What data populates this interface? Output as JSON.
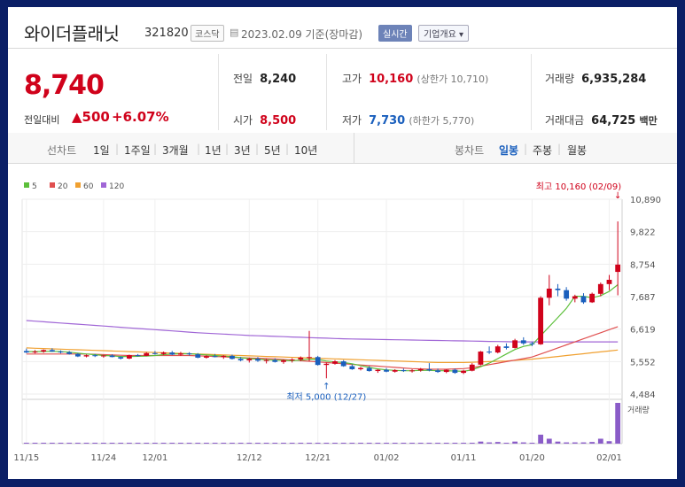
{
  "header": {
    "name": "와이더플래닛",
    "code": "321820",
    "market": "코스닥",
    "date_text": "2023.02.09 기준(장마감)",
    "realtime_label": "실시간",
    "overview_label": "기업개요 ▾"
  },
  "summary": {
    "price": "8,740",
    "change_label": "전일대비",
    "change_arrow": "▲",
    "change": "500",
    "change_pct": "+6.07%",
    "prev_label": "전일",
    "prev": "8,240",
    "high_label": "고가",
    "high": "10,160",
    "high_sub": "(상한가 10,710)",
    "volume_label": "거래량",
    "volume": "6,935,284",
    "open_label": "시가",
    "open": "8,500",
    "low_label": "저가",
    "low": "7,730",
    "low_sub": "(하한가 5,770)",
    "amount_label": "거래대금",
    "amount": "64,725",
    "amount_unit": "백만"
  },
  "toolbar": {
    "line_label": "선차트",
    "periods": [
      "1일",
      "1주일",
      "3개월",
      "1년",
      "3년",
      "5년",
      "10년"
    ],
    "candle_label": "봉차트",
    "candle_daily": "일봉",
    "candle_weekly": "주봉",
    "candle_monthly": "월봉"
  },
  "colors": {
    "up": "#d0021b",
    "down": "#1a5fbd",
    "ma5": "#5cbf3a",
    "ma20": "#e05050",
    "ma60": "#f0a030",
    "ma120": "#a066d6",
    "volume": "#8a5cc8"
  },
  "chart_data": {
    "type": "candlestick",
    "legend": [
      "5",
      "20",
      "60",
      "120"
    ],
    "y_ticks": [
      "10,890",
      "9,822",
      "8,754",
      "7,687",
      "6,619",
      "5,552",
      "4,484"
    ],
    "ylim": [
      4484,
      10890
    ],
    "x_ticks": [
      "11/15",
      "11/24",
      "12/01",
      "12/12",
      "12/21",
      "01/02",
      "01/11",
      "01/20",
      "02/01"
    ],
    "volume_label": "거래량",
    "annotations": {
      "high": "최고 10,160 (02/09)",
      "low": "최저 5,000 (12/27)"
    },
    "candles": [
      {
        "o": 5900,
        "h": 5980,
        "l": 5830,
        "c": 5850
      },
      {
        "o": 5850,
        "h": 5930,
        "l": 5820,
        "c": 5880
      },
      {
        "o": 5880,
        "h": 5950,
        "l": 5840,
        "c": 5930
      },
      {
        "o": 5930,
        "h": 5990,
        "l": 5870,
        "c": 5880
      },
      {
        "o": 5880,
        "h": 5920,
        "l": 5820,
        "c": 5860
      },
      {
        "o": 5860,
        "h": 5900,
        "l": 5780,
        "c": 5800
      },
      {
        "o": 5800,
        "h": 5830,
        "l": 5700,
        "c": 5720
      },
      {
        "o": 5720,
        "h": 5780,
        "l": 5690,
        "c": 5760
      },
      {
        "o": 5760,
        "h": 5800,
        "l": 5700,
        "c": 5730
      },
      {
        "o": 5730,
        "h": 5770,
        "l": 5680,
        "c": 5750
      },
      {
        "o": 5750,
        "h": 5790,
        "l": 5690,
        "c": 5700
      },
      {
        "o": 5700,
        "h": 5720,
        "l": 5620,
        "c": 5650
      },
      {
        "o": 5650,
        "h": 5780,
        "l": 5630,
        "c": 5760
      },
      {
        "o": 5760,
        "h": 5800,
        "l": 5720,
        "c": 5740
      },
      {
        "o": 5740,
        "h": 5860,
        "l": 5730,
        "c": 5830
      },
      {
        "o": 5830,
        "h": 5900,
        "l": 5780,
        "c": 5800
      },
      {
        "o": 5800,
        "h": 5880,
        "l": 5770,
        "c": 5850
      },
      {
        "o": 5850,
        "h": 5900,
        "l": 5760,
        "c": 5780
      },
      {
        "o": 5780,
        "h": 5870,
        "l": 5740,
        "c": 5820
      },
      {
        "o": 5820,
        "h": 5860,
        "l": 5750,
        "c": 5790
      },
      {
        "o": 5790,
        "h": 5830,
        "l": 5660,
        "c": 5680
      },
      {
        "o": 5680,
        "h": 5760,
        "l": 5650,
        "c": 5730
      },
      {
        "o": 5730,
        "h": 5800,
        "l": 5690,
        "c": 5700
      },
      {
        "o": 5700,
        "h": 5760,
        "l": 5640,
        "c": 5740
      },
      {
        "o": 5740,
        "h": 5780,
        "l": 5620,
        "c": 5640
      },
      {
        "o": 5640,
        "h": 5700,
        "l": 5560,
        "c": 5590
      },
      {
        "o": 5590,
        "h": 5680,
        "l": 5520,
        "c": 5640
      },
      {
        "o": 5640,
        "h": 5700,
        "l": 5540,
        "c": 5580
      },
      {
        "o": 5580,
        "h": 5640,
        "l": 5490,
        "c": 5600
      },
      {
        "o": 5600,
        "h": 5660,
        "l": 5520,
        "c": 5540
      },
      {
        "o": 5540,
        "h": 5620,
        "l": 5480,
        "c": 5590
      },
      {
        "o": 5590,
        "h": 5660,
        "l": 5520,
        "c": 5620
      },
      {
        "o": 5620,
        "h": 5720,
        "l": 5560,
        "c": 5680
      },
      {
        "o": 5680,
        "h": 6560,
        "l": 5560,
        "c": 5700
      },
      {
        "o": 5700,
        "h": 5740,
        "l": 5420,
        "c": 5440
      },
      {
        "o": 5440,
        "h": 5520,
        "l": 5000,
        "c": 5480
      },
      {
        "o": 5480,
        "h": 5600,
        "l": 5450,
        "c": 5560
      },
      {
        "o": 5560,
        "h": 5600,
        "l": 5380,
        "c": 5400
      },
      {
        "o": 5400,
        "h": 5460,
        "l": 5280,
        "c": 5300
      },
      {
        "o": 5300,
        "h": 5380,
        "l": 5260,
        "c": 5340
      },
      {
        "o": 5340,
        "h": 5400,
        "l": 5220,
        "c": 5240
      },
      {
        "o": 5240,
        "h": 5300,
        "l": 5180,
        "c": 5280
      },
      {
        "o": 5280,
        "h": 5340,
        "l": 5200,
        "c": 5220
      },
      {
        "o": 5220,
        "h": 5300,
        "l": 5190,
        "c": 5270
      },
      {
        "o": 5270,
        "h": 5320,
        "l": 5210,
        "c": 5240
      },
      {
        "o": 5240,
        "h": 5300,
        "l": 5190,
        "c": 5260
      },
      {
        "o": 5260,
        "h": 5340,
        "l": 5220,
        "c": 5300
      },
      {
        "o": 5300,
        "h": 5500,
        "l": 5230,
        "c": 5260
      },
      {
        "o": 5260,
        "h": 5320,
        "l": 5180,
        "c": 5210
      },
      {
        "o": 5210,
        "h": 5300,
        "l": 5170,
        "c": 5280
      },
      {
        "o": 5280,
        "h": 5320,
        "l": 5150,
        "c": 5180
      },
      {
        "o": 5180,
        "h": 5280,
        "l": 5140,
        "c": 5250
      },
      {
        "o": 5250,
        "h": 5500,
        "l": 5230,
        "c": 5450
      },
      {
        "o": 5450,
        "h": 5900,
        "l": 5430,
        "c": 5880
      },
      {
        "o": 5880,
        "h": 6050,
        "l": 5800,
        "c": 5850
      },
      {
        "o": 5850,
        "h": 6100,
        "l": 5820,
        "c": 6050
      },
      {
        "o": 6050,
        "h": 6150,
        "l": 5950,
        "c": 6000
      },
      {
        "o": 6000,
        "h": 6300,
        "l": 5980,
        "c": 6250
      },
      {
        "o": 6250,
        "h": 6350,
        "l": 6100,
        "c": 6150
      },
      {
        "o": 6150,
        "h": 6200,
        "l": 6060,
        "c": 6120
      },
      {
        "o": 6120,
        "h": 7700,
        "l": 6100,
        "c": 7650
      },
      {
        "o": 7650,
        "h": 8400,
        "l": 7400,
        "c": 7950
      },
      {
        "o": 7950,
        "h": 8100,
        "l": 7700,
        "c": 7900
      },
      {
        "o": 7900,
        "h": 8000,
        "l": 7550,
        "c": 7620
      },
      {
        "o": 7620,
        "h": 7750,
        "l": 7500,
        "c": 7700
      },
      {
        "o": 7700,
        "h": 7800,
        "l": 7450,
        "c": 7500
      },
      {
        "o": 7500,
        "h": 7820,
        "l": 7480,
        "c": 7780
      },
      {
        "o": 7780,
        "h": 8150,
        "l": 7700,
        "c": 8100
      },
      {
        "o": 8100,
        "h": 8400,
        "l": 7900,
        "c": 8240
      },
      {
        "o": 8500,
        "h": 10160,
        "l": 7730,
        "c": 8740
      }
    ],
    "ma5": [
      5880,
      5880,
      5885,
      5890,
      5880,
      5860,
      5830,
      5800,
      5780,
      5750,
      5740,
      5720,
      5720,
      5725,
      5730,
      5750,
      5780,
      5800,
      5810,
      5810,
      5790,
      5770,
      5750,
      5730,
      5710,
      5680,
      5650,
      5630,
      5610,
      5600,
      5590,
      5580,
      5600,
      5630,
      5620,
      5570,
      5540,
      5520,
      5480,
      5420,
      5360,
      5310,
      5280,
      5260,
      5250,
      5250,
      5260,
      5260,
      5250,
      5250,
      5240,
      5230,
      5280,
      5380,
      5500,
      5650,
      5800,
      5950,
      6050,
      6100,
      6400,
      6700,
      7000,
      7300,
      7700,
      7700,
      7650,
      7720,
      7860,
      8080
    ],
    "ma20": [
      5800,
      5800,
      5800,
      5800,
      5800,
      5800,
      5800,
      5800,
      5790,
      5780,
      5770,
      5760,
      5750,
      5750,
      5750,
      5750,
      5750,
      5750,
      5750,
      5750,
      5740,
      5730,
      5720,
      5710,
      5690,
      5680,
      5670,
      5660,
      5650,
      5640,
      5620,
      5600,
      5580,
      5560,
      5540,
      5520,
      5500,
      5480,
      5460,
      5440,
      5420,
      5400,
      5380,
      5360,
      5340,
      5320,
      5310,
      5300,
      5300,
      5300,
      5310,
      5320,
      5350,
      5400,
      5450,
      5500,
      5550,
      5600,
      5650,
      5700,
      5800,
      5900,
      6000,
      6100,
      6200,
      6300,
      6400,
      6500,
      6600,
      6700
    ],
    "ma60": [
      6000,
      5990,
      5980,
      5970,
      5960,
      5950,
      5940,
      5930,
      5920,
      5910,
      5900,
      5890,
      5880,
      5870,
      5860,
      5850,
      5840,
      5830,
      5820,
      5810,
      5800,
      5790,
      5780,
      5770,
      5760,
      5750,
      5740,
      5730,
      5720,
      5710,
      5700,
      5690,
      5680,
      5670,
      5660,
      5650,
      5640,
      5630,
      5620,
      5610,
      5600,
      5590,
      5580,
      5570,
      5560,
      5550,
      5540,
      5530,
      5520,
      5520,
      5520,
      5520,
      5530,
      5540,
      5550,
      5560,
      5570,
      5590,
      5610,
      5630,
      5660,
      5690,
      5720,
      5750,
      5780,
      5810,
      5840,
      5870,
      5900,
      5930
    ],
    "ma120": [
      6900,
      6880,
      6860,
      6840,
      6820,
      6800,
      6780,
      6760,
      6740,
      6720,
      6700,
      6680,
      6660,
      6640,
      6620,
      6600,
      6580,
      6560,
      6540,
      6520,
      6500,
      6485,
      6470,
      6455,
      6440,
      6425,
      6410,
      6400,
      6390,
      6380,
      6370,
      6360,
      6350,
      6340,
      6330,
      6320,
      6310,
      6300,
      6295,
      6290,
      6285,
      6280,
      6275,
      6270,
      6265,
      6260,
      6255,
      6250,
      6245,
      6240,
      6235,
      6230,
      6225,
      6220,
      6215,
      6210,
      6205,
      6200,
      6200,
      6200,
      6200,
      6200,
      6200,
      6200,
      6200,
      6200,
      6200,
      6200,
      6200,
      6200
    ],
    "volume": [
      0.01,
      0.01,
      0.01,
      0.01,
      0.01,
      0.01,
      0.01,
      0.01,
      0.01,
      0.01,
      0.01,
      0.01,
      0.01,
      0.01,
      0.01,
      0.01,
      0.01,
      0.01,
      0.01,
      0.01,
      0.01,
      0.01,
      0.01,
      0.01,
      0.01,
      0.01,
      0.01,
      0.01,
      0.01,
      0.01,
      0.01,
      0.01,
      0.01,
      0.02,
      0.01,
      0.02,
      0.01,
      0.01,
      0.01,
      0.01,
      0.01,
      0.01,
      0.01,
      0.01,
      0.01,
      0.01,
      0.01,
      0.01,
      0.01,
      0.01,
      0.01,
      0.01,
      0.02,
      0.05,
      0.03,
      0.04,
      0.02,
      0.05,
      0.03,
      0.02,
      0.22,
      0.12,
      0.05,
      0.03,
      0.03,
      0.03,
      0.04,
      0.12,
      0.06,
      1.0
    ]
  }
}
